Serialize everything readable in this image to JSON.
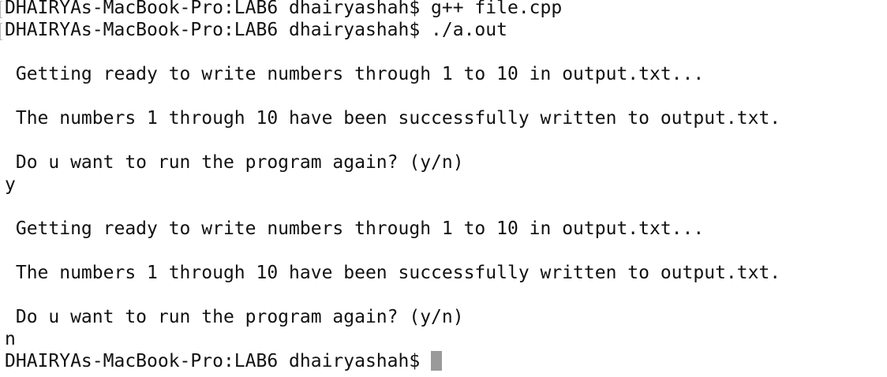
{
  "terminal": {
    "prompt": "DHAIRYAs-MacBook-Pro:LAB6 dhairyashah$",
    "lines": [
      "DHAIRYAs-MacBook-Pro:LAB6 dhairyashah$ g++ file.cpp",
      "DHAIRYAs-MacBook-Pro:LAB6 dhairyashah$ ./a.out",
      " Getting ready to write numbers through 1 to 10 in output.txt...",
      " The numbers 1 through 10 have been successfully written to output.txt.",
      " Do u want to run the program again? (y/n)",
      "y",
      " Getting ready to write numbers through 1 to 10 in output.txt...",
      " The numbers 1 through 10 have been successfully written to output.txt.",
      " Do u want to run the program again? (y/n)",
      "n"
    ],
    "cursor_color": "#9a9a9a"
  }
}
